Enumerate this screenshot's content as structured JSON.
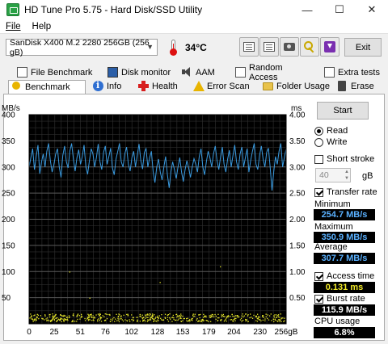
{
  "window": {
    "title": "HD Tune Pro 5.75 - Hard Disk/SSD Utility",
    "minimize": "—",
    "maximize": "☐",
    "close": "✕"
  },
  "menu": [
    {
      "label": "File"
    },
    {
      "label": "Help"
    }
  ],
  "toolbar": {
    "drive": "SanDisk X400 M.2 2280 256GB (256 gB)",
    "temperature": "34°C",
    "exit_label": "Exit",
    "buttons": [
      "copy-text-icon",
      "copy-info-icon",
      "screenshot-icon",
      "options-icon",
      "save-icon"
    ]
  },
  "tabs": {
    "row1": [
      {
        "label": "File Benchmark",
        "icon": "file-benchmark-icon"
      },
      {
        "label": "Disk monitor",
        "icon": "monitor-icon"
      },
      {
        "label": "AAM",
        "icon": "speaker-icon"
      },
      {
        "label": "Random Access",
        "icon": "random-access-icon"
      },
      {
        "label": "Extra tests",
        "icon": "extra-tests-icon"
      }
    ],
    "row2": [
      {
        "label": "Benchmark",
        "icon": "award-icon",
        "selected": true
      },
      {
        "label": "Info",
        "icon": "info-icon"
      },
      {
        "label": "Health",
        "icon": "health-icon"
      },
      {
        "label": "Error Scan",
        "icon": "warning-icon"
      },
      {
        "label": "Folder Usage",
        "icon": "folder-icon"
      },
      {
        "label": "Erase",
        "icon": "trash-icon"
      }
    ]
  },
  "side": {
    "start_label": "Start",
    "read_label": "Read",
    "write_label": "Write",
    "read_selected": true,
    "short_stroke_label": "Short stroke",
    "short_stroke_checked": false,
    "short_stroke_value": "40",
    "short_stroke_unit": "gB",
    "transfer_rate_label": "Transfer rate",
    "transfer_rate_checked": true,
    "minimum_label": "Minimum",
    "minimum_value": "254.7 MB/s",
    "maximum_label": "Maximum",
    "maximum_value": "350.9 MB/s",
    "average_label": "Average",
    "average_value": "307.7 MB/s",
    "access_time_label": "Access time",
    "access_time_checked": true,
    "access_time_value": "0.131 ms",
    "burst_rate_label": "Burst rate",
    "burst_rate_checked": true,
    "burst_rate_value": "115.9 MB/s",
    "cpu_usage_label": "CPU usage",
    "cpu_usage_value": "6.8%"
  },
  "chart_data": {
    "type": "line",
    "ylabel_left": "MB/s",
    "ylabel_right": "ms",
    "x_unit": "gB",
    "y_ticks_left": [
      "400",
      "350",
      "300",
      "250",
      "200",
      "150",
      "100",
      "50"
    ],
    "y_ticks_right": [
      "4.00",
      "3.50",
      "3.00",
      "2.50",
      "2.00",
      "1.50",
      "1.00",
      "0.50"
    ],
    "x_ticks": [
      "0",
      "25",
      "51",
      "76",
      "102",
      "128",
      "153",
      "179",
      "204",
      "230",
      "256gB"
    ],
    "xlim": [
      0,
      256
    ],
    "ylim_left": [
      0,
      400
    ],
    "ylim_right": [
      0,
      4
    ],
    "grid": true,
    "background": "#000000",
    "series": [
      {
        "color": "#3a9be0",
        "values": [
          300,
          318,
          335,
          295,
          320,
          342,
          287,
          310,
          325,
          300,
          330,
          345,
          312,
          290,
          305,
          325,
          335,
          300,
          280,
          322,
          340,
          310,
          298,
          330,
          345,
          315,
          292,
          318,
          333,
          305,
          320,
          342,
          300,
          286,
          312,
          335,
          325,
          300,
          318,
          344,
          310,
          295,
          328,
          340,
          305,
          320,
          336,
          298,
          285,
          315,
          330,
          345,
          310,
          300,
          325,
          338,
          305,
          292,
          318,
          330,
          300,
          322,
          344,
          312,
          296,
          328,
          335,
          300,
          318,
          330,
          290,
          270,
          300,
          315,
          290,
          275,
          300,
          320,
          285,
          260,
          290,
          310,
          295,
          278,
          300,
          318,
          290,
          272,
          295,
          312,
          298,
          280,
          300,
          316,
          305,
          290,
          320,
          335,
          300,
          285,
          310,
          330,
          318,
          300,
          325,
          340,
          312,
          295,
          320,
          338,
          305,
          290,
          315,
          332,
          300,
          322,
          342,
          310,
          295,
          325,
          338,
          300,
          318,
          335,
          290,
          312,
          330,
          345,
          305,
          295,
          322,
          340,
          315,
          300,
          328,
          336,
          298,
          255,
          290,
          320,
          305,
          330,
          345,
          300,
          318,
          335
        ]
      }
    ],
    "scatter_series": [
      {
        "color": "#e6e62a",
        "axis": "right",
        "typical_value_ms": 0.13,
        "value_range_ms": [
          0.05,
          0.2
        ],
        "outliers_ms": [
          0.5,
          0.8,
          1.0,
          1.1
        ]
      }
    ]
  }
}
